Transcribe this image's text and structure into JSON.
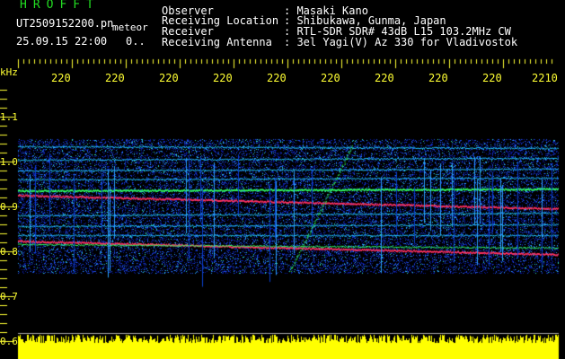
{
  "header": {
    "brand": "HROFFT",
    "filename": "UT2509152200.pn",
    "meteor_label": "meteor",
    "datetime": "25.09.15 22:00",
    "count": "0..",
    "fields": [
      {
        "label": "Observer",
        "value": ": Masaki Kano"
      },
      {
        "label": "Receiving Location",
        "value": ": Shibukawa, Gunma, Japan"
      },
      {
        "label": "Receiver",
        "value": ": RTL-SDR SDR# 43dB L15 103.2MHz CW"
      },
      {
        "label": "Receiving Antenna",
        "value": ": 3el Yagi(V) Az 330 for Vladivostok"
      }
    ]
  },
  "axes": {
    "y_unit": "kHz",
    "y_ticks": [
      "1.1",
      "1.0",
      "0.9",
      "0.8",
      "0.7",
      "0.6"
    ],
    "x_ticks": [
      "220",
      "220",
      "220",
      "220",
      "220",
      "220",
      "220",
      "220",
      "220",
      "2210"
    ]
  },
  "colors": {
    "axis_text": "#ffff33",
    "brand": "#22dd22",
    "noise_bar": "#ffff00",
    "background": "#000000"
  }
}
